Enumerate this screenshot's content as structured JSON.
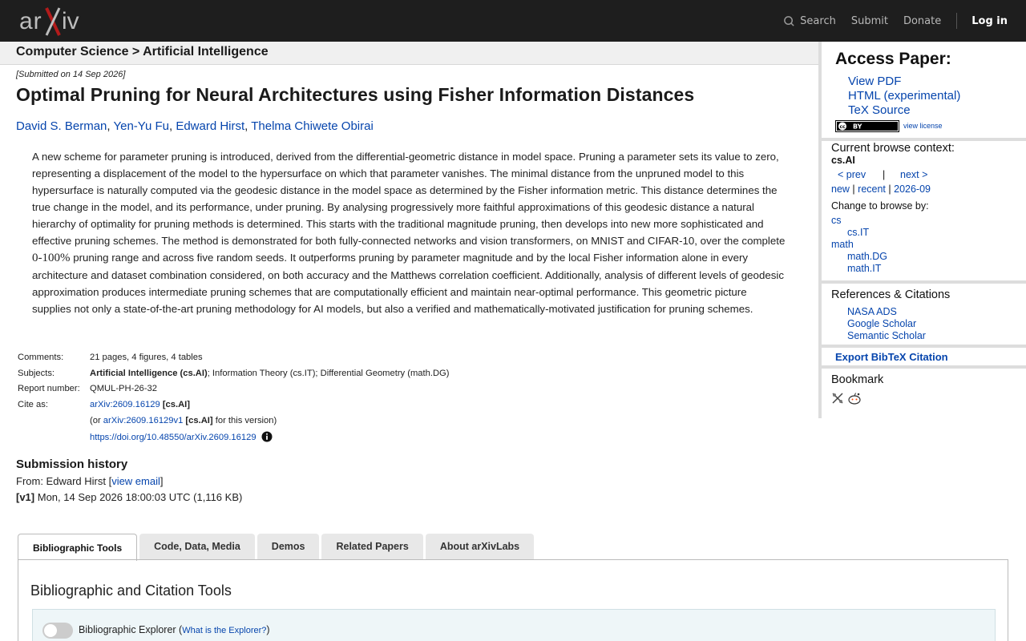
{
  "header": {
    "logo_text": "arXiv",
    "nav": {
      "search": "Search",
      "submit": "Submit",
      "donate": "Donate",
      "login": "Log in"
    }
  },
  "breadcrumb": "Computer Science > Artificial Intelligence",
  "paper": {
    "submitted": "[Submitted on 14 Sep 2026]",
    "title": "Optimal Pruning for Neural Architectures using Fisher Information Distances",
    "authors": [
      "David S. Berman",
      "Yen-Yu Fu",
      "Edward Hirst",
      "Thelma Chiwete Obirai"
    ],
    "abstract_part1": "A new scheme for parameter pruning is introduced, derived from the differential-geometric distance in model space. Pruning a parameter sets its value to zero, representing a displacement of the model to the hypersurface on which that parameter vanishes. The minimal distance from the unpruned model to this hypersurface is naturally computed via the geodesic distance in the model space as determined by the Fisher information metric. This distance determines the true change in the model, and its performance, under pruning. By analysing progressively more faithful approximations of this geodesic distance a natural hierarchy of optimality for pruning methods is determined. This starts with the traditional magnitude pruning, then develops into new more sophisticated and effective pruning schemes. The method is demonstrated for both fully-connected networks and vision transformers, on MNIST and CIFAR-10, over the complete ",
    "abstract_math": "0-100%",
    "abstract_part2": " pruning range and across five random seeds. It outperforms pruning by parameter magnitude and by the local Fisher information alone in every architecture and dataset combination considered, on both accuracy and the Matthews correlation coefficient. Additionally, analysis of different levels of geodesic approximation produces intermediate pruning schemes that are computationally efficient and maintain near-optimal performance. This geometric picture supplies not only a state-of-the-art pruning methodology for AI models, but also a verified and mathematically-motivated justification for pruning schemes.",
    "meta": {
      "comments_label": "Comments:",
      "comments": "21 pages, 4 figures, 4 tables",
      "subjects_label": "Subjects:",
      "subjects_primary": "Artificial Intelligence (cs.AI)",
      "subjects_rest": "; Information Theory (cs.IT); Differential Geometry (math.DG)",
      "report_label": "Report number:",
      "report": "QMUL-PH-26-32",
      "cite_label": "Cite as:",
      "cite_id": "arXiv:2609.16129",
      "cite_tag": "[cs.AI]",
      "cite_or_prefix": "(or ",
      "cite_v1": "arXiv:2609.16129v1",
      "cite_v1_tag": "[cs.AI]",
      "cite_or_suffix": " for this version)",
      "doi": "https://doi.org/10.48550/arXiv.2609.16129"
    },
    "history": {
      "heading": "Submission history",
      "from_prefix": "From: Edward Hirst [",
      "view_email": "view email",
      "from_suffix": "]",
      "version_tag": "[v1]",
      "version_text": " Mon, 14 Sep 2026 18:00:03 UTC (1,116 KB)"
    }
  },
  "tabs": [
    "Bibliographic Tools",
    "Code, Data, Media",
    "Demos",
    "Related Papers",
    "About arXivLabs"
  ],
  "tab_panel": {
    "heading": "Bibliographic and Citation Tools",
    "explorer_label": "Bibliographic Explorer (",
    "explorer_link": "What is the Explorer?",
    "explorer_close": ")"
  },
  "sidebar": {
    "access_title": "Access Paper:",
    "access_links": [
      "View PDF",
      "HTML (experimental)",
      "TeX Source"
    ],
    "view_license": "view license",
    "context_heading": "Current browse context:",
    "context_value": "cs.AI",
    "prev": "< prev",
    "pipe": "|",
    "next": "next >",
    "new": "new",
    "recent": "recent",
    "month": "2026-09",
    "change_heading": "Change to browse by:",
    "browse": [
      "cs",
      "cs.IT",
      "math",
      "math.DG",
      "math.IT"
    ],
    "refs_heading": "References & Citations",
    "refs": [
      "NASA ADS",
      "Google Scholar",
      "Semantic Scholar"
    ],
    "export": "Export BibTeX Citation",
    "bookmark": "Bookmark"
  }
}
